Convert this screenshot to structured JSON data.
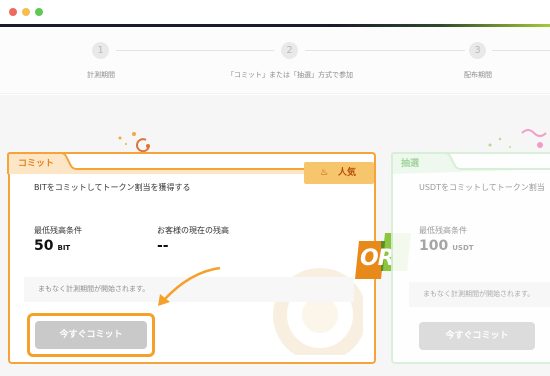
{
  "window": {
    "traffic_lights": [
      "#ee6a5f",
      "#f5be4f",
      "#62c655"
    ]
  },
  "steps": [
    {
      "number": "1",
      "label": "計測期間"
    },
    {
      "number": "2",
      "label": "「コミット」または「抽選」方式で参加"
    },
    {
      "number": "3",
      "label": "配布期間"
    }
  ],
  "commit_card": {
    "title": "コミット",
    "badge": "人気",
    "description": "BITをコミットしてトークン割当を獲得する",
    "min_balance_label": "最低残高条件",
    "min_balance_value": "50",
    "min_balance_unit": "BIT",
    "current_balance_label": "お客様の現在の残高",
    "current_balance_value": "--",
    "notice": "まもなく計測期間が開始されます。",
    "button": "今すぐコミット"
  },
  "or_label": "OR",
  "lottery_card": {
    "title": "抽選",
    "description": "USDTをコミットしてトークン割当",
    "min_balance_label": "最低残高条件",
    "min_balance_value": "100",
    "min_balance_unit": "USDT",
    "notice": "まもなく計測期間が開始されます。",
    "button": "今すぐコミット"
  },
  "colors": {
    "accent_orange": "#f5a33a",
    "accent_green": "#8cc63f",
    "button_disabled": "#c9c9c9"
  }
}
